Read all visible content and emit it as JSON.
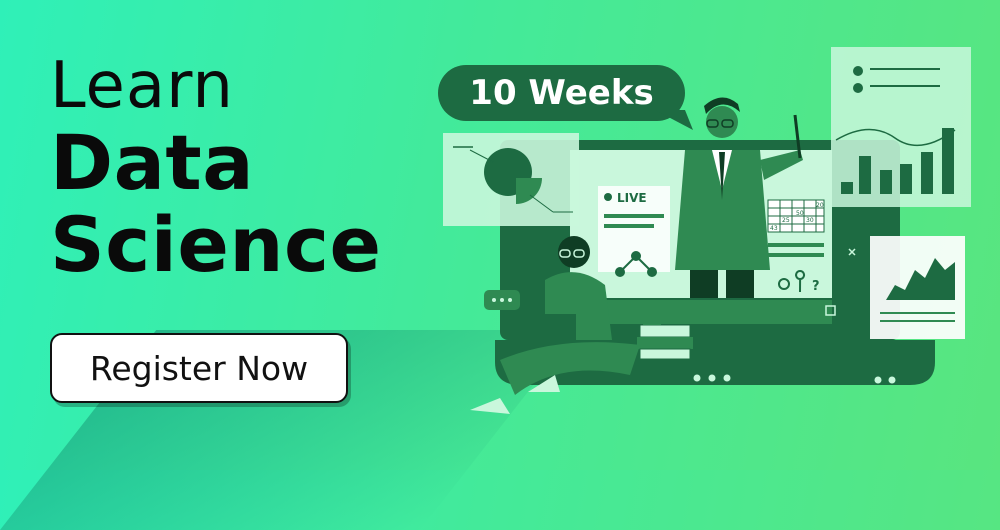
{
  "banner": {
    "headline_line1": "Learn",
    "headline_line2": "Data",
    "headline_line3": "Science",
    "cta_label": "Register Now",
    "duration_badge": "10 Weeks"
  },
  "illustration": {
    "live_label": "LIVE",
    "calendar_numbers": [
      "20",
      "50",
      "25",
      "30",
      "43"
    ]
  },
  "colors": {
    "dark_green": "#1d6b42",
    "mid_green": "#2f8a52",
    "light_green": "#c9f7dc",
    "text": "#0a0a0a"
  }
}
